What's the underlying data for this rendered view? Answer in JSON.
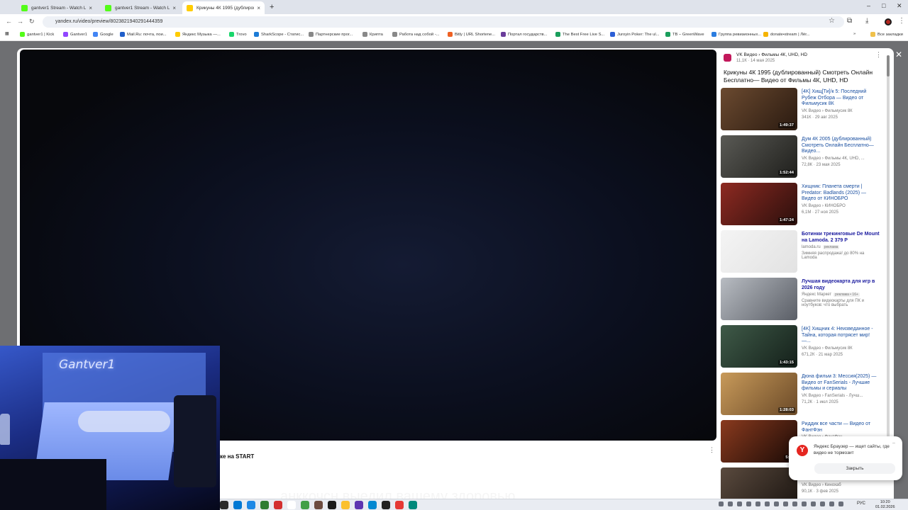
{
  "tabs": [
    {
      "label": "gantver1 Stream - Watch Live o",
      "color": "#53fc18",
      "active": false
    },
    {
      "label": "gantver1 Stream - Watch Live o",
      "color": "#53fc18",
      "active": false
    },
    {
      "label": "Крикуны 4К 1995 (дублирова",
      "color": "#ffcc00",
      "active": true
    }
  ],
  "tab_close": "×",
  "new_tab": "+",
  "window_controls": {
    "minimize": "–",
    "maximize": "□",
    "close": "✕"
  },
  "url": "yandex.ru/video/preview/8023821940291444359",
  "bookmarks": [
    {
      "label": "gantver1 | Kick",
      "color": "#53fc18"
    },
    {
      "label": "Gantver1",
      "color": "#9146ff"
    },
    {
      "label": "Google",
      "color": "#4285f4"
    },
    {
      "label": "Mail.Ru: почта, пои...",
      "color": "#1f5ec9"
    },
    {
      "label": "Яндекс Музыка —...",
      "color": "#ffcc00"
    },
    {
      "label": "Trovo",
      "color": "#19d66b"
    },
    {
      "label": "SharkScope - Статис...",
      "color": "#1c7bd6"
    },
    {
      "label": "Партнерские прог...",
      "color": "#888888"
    },
    {
      "label": "Крипта",
      "color": "#888888"
    },
    {
      "label": "Работа над собой -...",
      "color": "#888888"
    },
    {
      "label": "Bitly | URL Shortene...",
      "color": "#ee6123"
    },
    {
      "label": "Портал государств...",
      "color": "#6a3d9a"
    },
    {
      "label": "The Best Free Live S...",
      "color": "#1a9e5c"
    },
    {
      "label": "Juroyin Poker: The ul...",
      "color": "#2c5fd6"
    },
    {
      "label": "TB – GreenWave",
      "color": "#1a9e5c"
    },
    {
      "label": "Группа ревизионных...",
      "color": "#2b7de0"
    },
    {
      "label": "donate•stream | Лёг...",
      "color": "#f5b400"
    }
  ],
  "bookmarks_more": "»",
  "all_bookmarks": "Все закладки",
  "video": {
    "below_title": "ке на START",
    "subtitle": "анккочсн выедил вашему здоровью"
  },
  "sidebar": {
    "source_name": "VK Видео › Фильмы 4К, UHD, HD",
    "source_meta": "11,1К · 14 мая 2025",
    "title": "Крикуны 4К 1995 (дублированный) Смотреть Онлайн Бесплатно— Видео от Фильмы 4К, UHD, HD",
    "items": [
      {
        "title": "[4K] Хищ[Ти]/к 5: Последний Рубеж Отбора — Видео от Фильмусик 8К",
        "channel": "VK Видео › Фильмусик 8К",
        "meta": "341К · 29 авг 2025",
        "duration": "1:49:37",
        "c1": "#6b4a30",
        "c2": "#2a1a10",
        "ad": false
      },
      {
        "title": "Дум 4К 2005 (дублированный) Смотреть Онлайн Бесплатно— Видео...",
        "channel": "VK Видео › Фильмы 4К, UHD, ...",
        "meta": "72,8К · 23 мая 2025",
        "duration": "1:52:44",
        "c1": "#5a5a55",
        "c2": "#1f1f1c",
        "ad": false
      },
      {
        "title": "Хищник: Планета смерти | Predator: Badlands (2025) — Видео от КИНОБРО",
        "channel": "VK Видео › КИНОБРО",
        "meta": "6,1М · 27 ноя 2025",
        "duration": "1:47:24",
        "c1": "#8e2a22",
        "c2": "#2b0f0c",
        "ad": false
      },
      {
        "title": "Ботинки трекинговые De Mount на Lamoda. 2 379 Р",
        "channel": "lamoda.ru",
        "meta": "Зимняя распродажа! до 80% на Lamoda",
        "duration": "",
        "c1": "#f4f4f4",
        "c2": "#e2e2e2",
        "ad": true
      },
      {
        "title": "Лучшая видеокарта для игр в 2026 году",
        "channel": "Яндекс Маркет",
        "meta": "Сравните видеокарты для ПК и ноутбуков: что выбрать",
        "duration": "",
        "c1": "#b8bcc2",
        "c2": "#5a5e66",
        "ad": true
      },
      {
        "title": "[4K] Хищник 4: Неизведанное - Тайна, которая потрясет мир! —...",
        "channel": "VK Видео › Фильмусик 8К",
        "meta": "671,2К · 21 мар 2025",
        "duration": "1:43:15",
        "c1": "#3f5a48",
        "c2": "#14201a",
        "ad": false
      },
      {
        "title": "Дюна фильм 3: Мессия(2025) — Видео от FanSerials - Лучшие фильмы и сериалы",
        "channel": "VK Видео › FanSerials - Лучш...",
        "meta": "71,2К · 1 июл 2025",
        "duration": "1:28:03",
        "c1": "#c89a5a",
        "c2": "#6b4a28",
        "ad": false
      },
      {
        "title": "Риддик все части — Видео от ФантФэн",
        "channel": "VK Видео › ФантФэн",
        "meta": "",
        "duration": "5:29",
        "c1": "#8a3a1e",
        "c2": "#1a0a06",
        "ad": false
      },
      {
        "title": "",
        "channel": "VK Видео › Кинохаб",
        "meta": "90,1К · 3 фев 2025",
        "duration": "",
        "c1": "#5a4a3e",
        "c2": "#1a1410",
        "ad": false
      }
    ],
    "ad_label": "реклама",
    "ad_label_2": "реклама • 16+"
  },
  "camera": {
    "overlay_text": "Gantver1"
  },
  "toast": {
    "text": "Яндекс Браузер — ищет сайты, где видео не тормозит",
    "button": "Закрыть",
    "logo": "Y"
  },
  "taskbar": {
    "apps": [
      {
        "color": "#2b2b2b"
      },
      {
        "color": "#0078d4"
      },
      {
        "color": "#1e88e5"
      },
      {
        "color": "#2e7d32"
      },
      {
        "color": "#d32f2f"
      },
      {
        "color": "#ffffff"
      },
      {
        "color": "#43a047"
      },
      {
        "color": "#6d4c41"
      },
      {
        "color": "#1a1a1a"
      },
      {
        "color": "#fbc02d"
      },
      {
        "color": "#5e35b1"
      },
      {
        "color": "#0288d1"
      },
      {
        "color": "#212121"
      },
      {
        "color": "#e53935"
      },
      {
        "color": "#00897b"
      }
    ],
    "language": "РУС",
    "time": "10:20",
    "date": "01.02.2026"
  }
}
